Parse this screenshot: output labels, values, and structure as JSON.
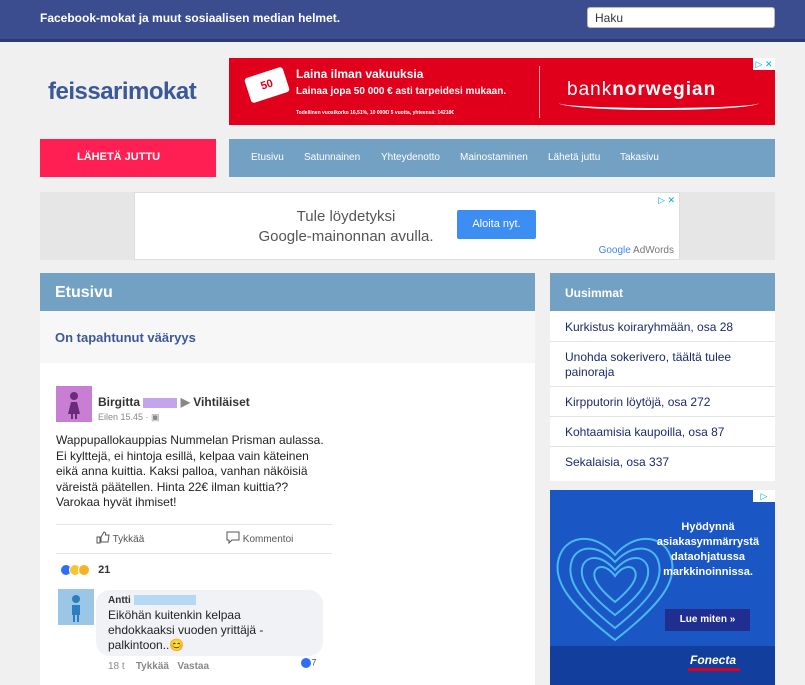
{
  "topbar": {
    "title": "Facebook-mokat ja muut sosiaalisen median helmet.",
    "search_placeholder": "Haku"
  },
  "logo": "feissarimokat",
  "ad_top": {
    "tag": "50",
    "headline": "Laina ilman vakuuksia",
    "subline": "Lainaa jopa 50 000 € asti tarpeidesi mukaan.",
    "fine": "Todellinen vuosikorko 16,51%, 10 000€/ 5 vuotta, yhteensä: 14218€",
    "brand_a": "bank",
    "brand_b": "norwegian",
    "choices": "▷ ✕"
  },
  "send_button": "LÄHETÄ JUTTU",
  "nav": [
    "Etusivu",
    "Satunnainen",
    "Yhteydenotto",
    "Mainostaminen",
    "Lähetä juttu",
    "Takasivu"
  ],
  "ad_google": {
    "text_line1": "Tule löydetyksi",
    "text_line2": "Google-mainonnan avulla.",
    "button": "Aloita nyt.",
    "logo_a": "Google",
    "logo_b": "AdWords",
    "choices": "▷ ✕"
  },
  "main": {
    "header": "Etusivu",
    "post_title": "On tapahtunut vääryys",
    "fb_post": {
      "author": "Birgitta",
      "group_arrow": "▶",
      "group": "Vihtiläiset",
      "meta": "Eilen 15.45 · ▣",
      "text": "Wappupallokauppias Nummelan Prisman aulassa. Ei kylttejä, ei hintoja esillä, kelpaa vain käteinen eikä anna kuittia. Kaksi palloa, vanhan näköisiä väreistä päätellen. Hinta 22€ ilman kuittia?? Varokaa hyvät ihmiset!",
      "like_label": "Tykkää",
      "comment_label": "Kommentoi",
      "reaction_count": "21",
      "comment": {
        "author": "Antti",
        "text": "Eiköhän kuitenkin kelpaa ehdokkaaksi vuoden yrittäjä -palkintoon..😊",
        "age": "18 t",
        "like": "Tykkää",
        "reply": "Vastaa",
        "likes": "7"
      }
    }
  },
  "sidebar": {
    "header": "Uusimmat",
    "items": [
      "Kurkistus koiraryhmään, osa 28",
      "Unohda sokerivero, täältä tulee painoraja",
      "Kirpputorin löytöjä, osa 272",
      "Kohtaamisia kaupoilla, osa 87",
      "Sekalaisia, osa 337"
    ]
  },
  "ad_side": {
    "text": "Hyödynnä asiakasymmärrystä dataohjatussa markkinoinnissa.",
    "button": "Lue miten »",
    "brand": "Fonecta",
    "choices": "▷"
  }
}
